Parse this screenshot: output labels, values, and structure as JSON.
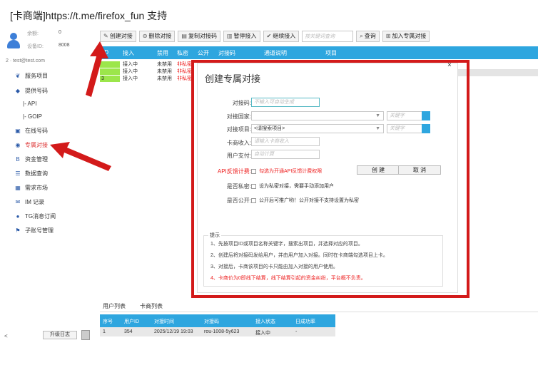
{
  "page_title": "[卡商端]https://t.me/firefox_fun 支持",
  "user": {
    "balance_label": "余额:",
    "balance_value": "0",
    "device_label": "设备ID:",
    "device_value": "8008",
    "email": "2 · test@test.com"
  },
  "sidebar": {
    "items": [
      {
        "label": "服务项目",
        "icon": "❦"
      },
      {
        "label": "提供号码",
        "icon": "◆"
      },
      {
        "label": "|- API",
        "icon": ""
      },
      {
        "label": "|- GOIP",
        "icon": ""
      },
      {
        "label": "在线号码",
        "icon": "▣"
      },
      {
        "label": "专属对接",
        "icon": "◉"
      },
      {
        "label": "资金管理",
        "icon": "B"
      },
      {
        "label": "数据查询",
        "icon": "☰"
      },
      {
        "label": "需求市场",
        "icon": "▦"
      },
      {
        "label": "IM 记录",
        "icon": "✉"
      },
      {
        "label": "TG消息订阅",
        "icon": "●"
      },
      {
        "label": "子账号管理",
        "icon": "⚑"
      }
    ],
    "collapse": "<",
    "upgrade": "升级日志"
  },
  "toolbar": {
    "create": "创建对接",
    "delete": "删除对接",
    "copy": "复制对接码",
    "pause": "暂停接入",
    "resume": "继续接入",
    "search_placeholder": "按关键词查询",
    "query": "查询",
    "add": "加入专属对接"
  },
  "grid": {
    "headers": [
      "ID",
      "接入",
      "禁用",
      "私密",
      "公开",
      "对接码",
      "通道说明",
      "项目"
    ],
    "rows": [
      {
        "id": "",
        "status": "接入中",
        "disabled": "未禁用",
        "private": "非私密"
      },
      {
        "id": "",
        "status": "接入中",
        "disabled": "未禁用",
        "private": "非私密"
      },
      {
        "id": "3",
        "status": "接入中",
        "disabled": "未禁用",
        "private": "非私密"
      }
    ]
  },
  "bottom": {
    "tabs": [
      "用户列表",
      "卡商列表"
    ],
    "headers": [
      "序号",
      "用户ID",
      "对接时间",
      "对接码",
      "接入状态",
      "日成功率"
    ],
    "rows": [
      [
        "1",
        "354",
        "2025/12/19 19:03",
        "rou-1008-5y623",
        "接入中",
        "-"
      ]
    ]
  },
  "modal": {
    "title": "创建专属对接",
    "close": "×",
    "code_label": "对接码:",
    "code_placeholder": "不输入可自动生成",
    "country_label": "对接国家:",
    "country_value": "",
    "project_label": "对接项目:",
    "project_value": "<请搜索项目>",
    "keyword_placeholder": "关键字",
    "income_label": "卡商收入:",
    "income_placeholder": "请输入卡商收入",
    "payment_label": "用户支付:",
    "payment_placeholder": "自动计算",
    "api_label": "API反馈计费:",
    "api_check": "勾选为开通API反馈计费权限",
    "create_btn": "创 建",
    "cancel_btn": "取 消",
    "private_label": "是否私密:",
    "private_check": "设为私密对接，需要手动添加用户",
    "public_label": "是否公开:",
    "public_check": "公开后可推广哟！公开对接不支持设置为私密",
    "tips_title": "提示",
    "tips": [
      "1、先按项目ID或项目名称关键字，搜索出项目，并选择对应的项目。",
      "2、创建后将对接码发给用户，并由用户加入对接。同时在卡商端勾选项目上卡。",
      "3、对接后，卡商该项目的卡只能由加入对接的用户使用。",
      "4、卡商价为0即线下结算，线下结算引起的资金纠纷，平台概不负责。"
    ]
  },
  "colors": {
    "accent": "#2ea6df",
    "highlight": "#d31a1a",
    "warn": "#e22222",
    "id_cell": "#9ce64b"
  }
}
